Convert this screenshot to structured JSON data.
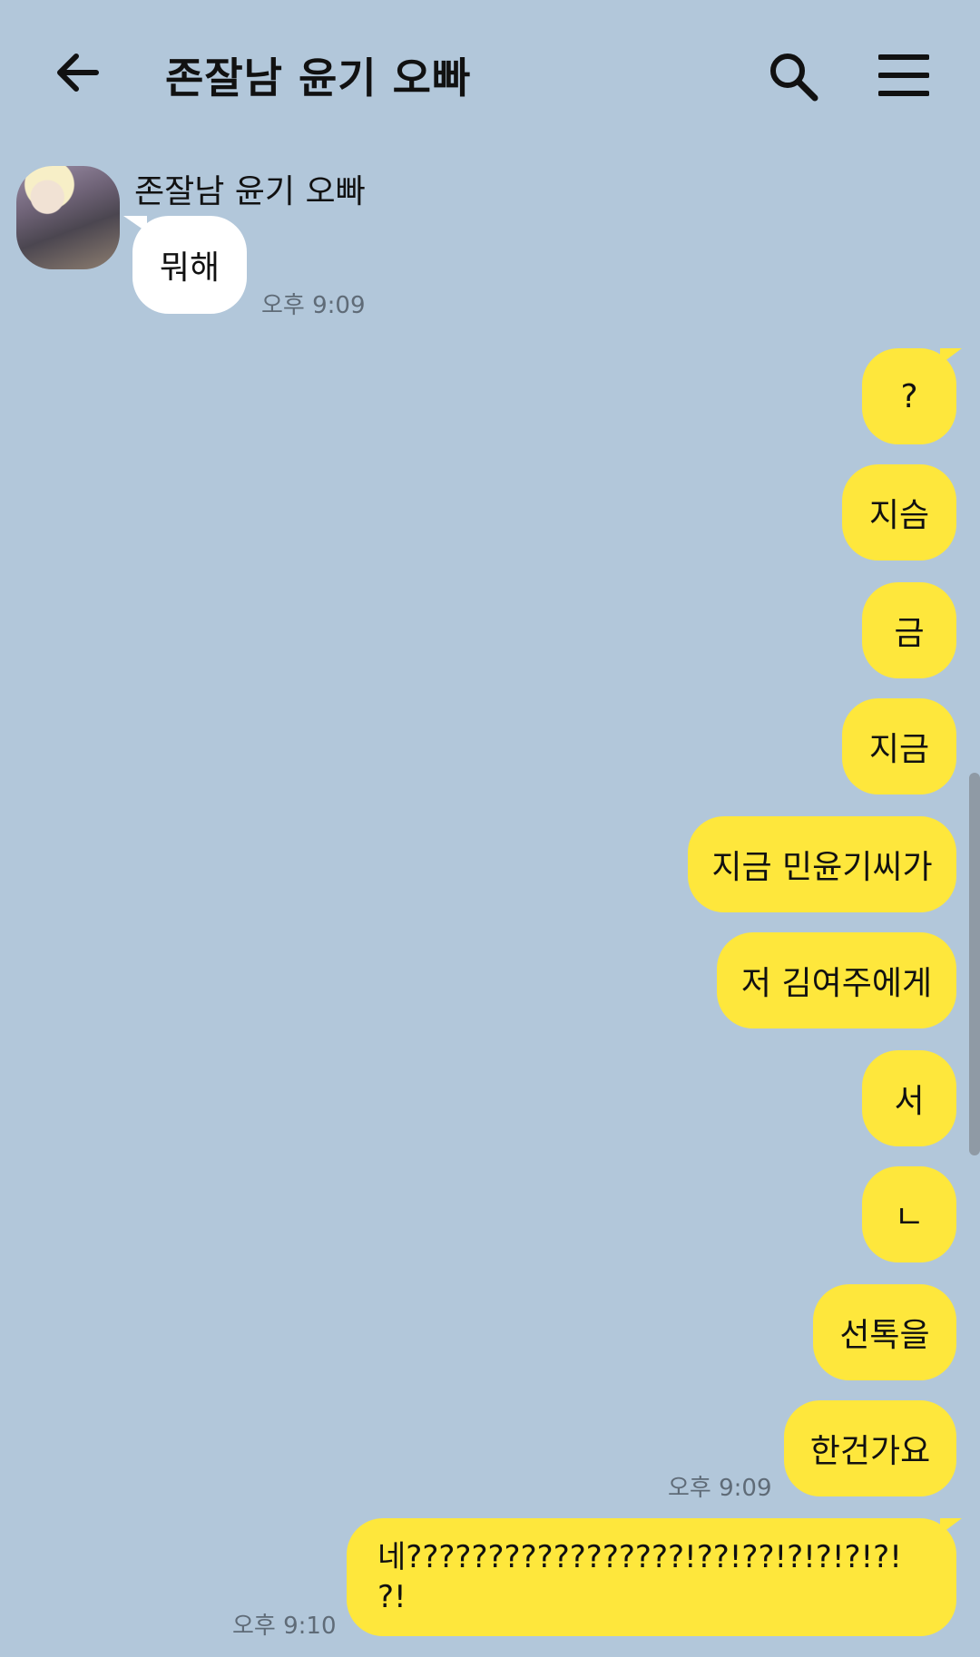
{
  "header": {
    "title": "존잘남 윤기 오빠",
    "back_icon": "arrow-left-icon",
    "search_icon": "search-icon",
    "menu_icon": "hamburger-menu-icon"
  },
  "colors": {
    "background": "#b2c7da",
    "incoming_bubble": "#ffffff",
    "outgoing_bubble": "#fee73c"
  },
  "incoming": {
    "sender": "존잘남 윤기 오빠",
    "message": "뭐해",
    "time": "오후 9:09"
  },
  "outgoing": [
    {
      "text": "?"
    },
    {
      "text": "지슴"
    },
    {
      "text": "금"
    },
    {
      "text": "지금"
    },
    {
      "text": "지금 민윤기씨가"
    },
    {
      "text": "저 김여주에게"
    },
    {
      "text": "서"
    },
    {
      "text": "ㄴ"
    },
    {
      "text": "선톡을"
    },
    {
      "text": "한건가요"
    }
  ],
  "outgoing_time_1": "오후 9:09",
  "last_message": {
    "line1": "네?????????????????!??!??!?!?!?!?!",
    "line2": "?!",
    "time": "오후 9:10"
  }
}
